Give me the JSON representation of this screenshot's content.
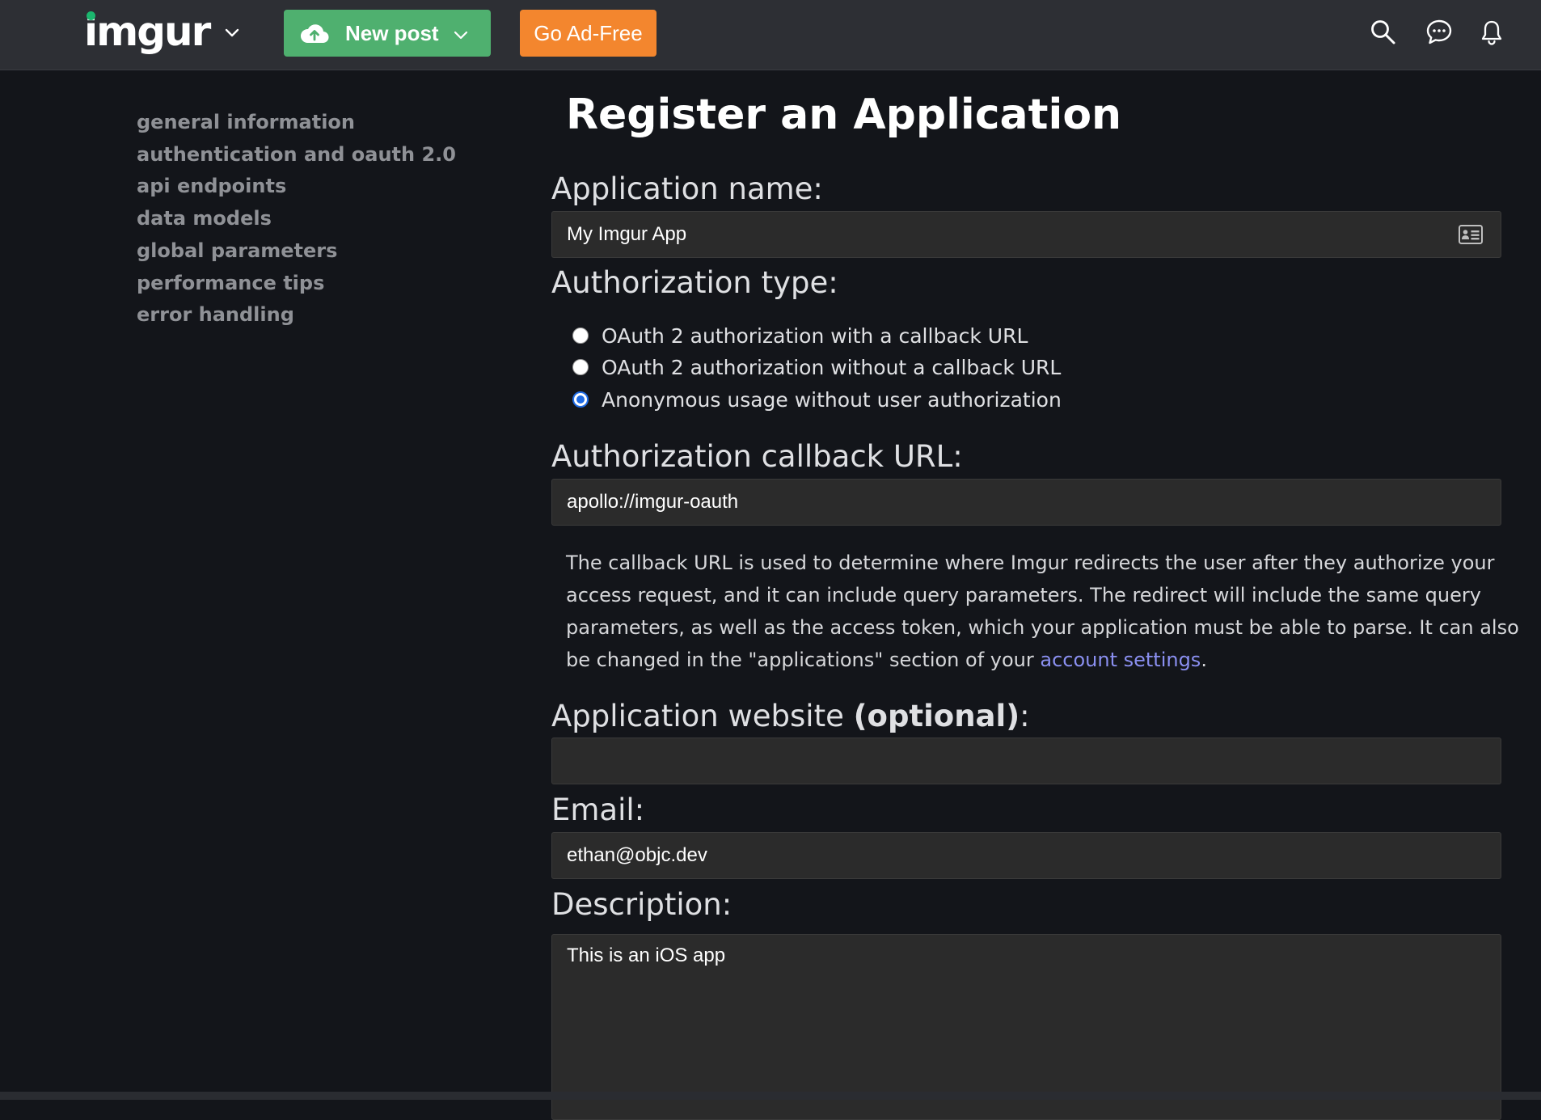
{
  "header": {
    "logo": "imgur",
    "new_post_label": "New post",
    "ad_free_label": "Go Ad-Free",
    "icons": [
      "search-icon",
      "chat-icon",
      "bell-icon"
    ],
    "colors": {
      "new_post": "#4fb06f",
      "ad_free": "#f3862e",
      "logo_dot": "#1bb76e"
    }
  },
  "sidebar": {
    "items": [
      {
        "label": "general information"
      },
      {
        "label": "authentication and oauth 2.0"
      },
      {
        "label": "api endpoints"
      },
      {
        "label": "data models"
      },
      {
        "label": "global parameters"
      },
      {
        "label": "performance tips"
      },
      {
        "label": "error handling"
      }
    ]
  },
  "form": {
    "title": "Register an Application",
    "app_name": {
      "label": "Application name:",
      "value": "My Imgur App"
    },
    "auth_type": {
      "label": "Authorization type:",
      "options": [
        {
          "label": "OAuth 2 authorization with a callback URL",
          "checked": false
        },
        {
          "label": "OAuth 2 authorization without a callback URL",
          "checked": false
        },
        {
          "label": "Anonymous usage without user authorization",
          "checked": true
        }
      ]
    },
    "callback": {
      "label": "Authorization callback URL:",
      "value": "apollo://imgur-oauth",
      "help_text": "The callback URL is used to determine where Imgur redirects the user after they authorize your access request, and it can include query parameters. The redirect will include the same query parameters, as well as the access token, which your application must be able to parse. It can also be changed in the \"applications\" section of your ",
      "help_link": "account settings",
      "help_end": "."
    },
    "website": {
      "label": "Application website ",
      "label_bold": "(optional)",
      "label_end": ":",
      "value": ""
    },
    "email": {
      "label": "Email:",
      "value": "ethan@objc.dev"
    },
    "description": {
      "label": "Description:",
      "value": "This is an iOS app"
    }
  }
}
